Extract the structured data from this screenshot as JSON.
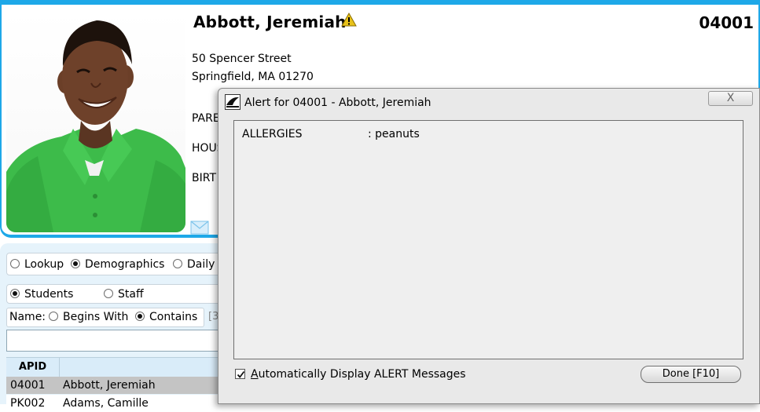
{
  "student": {
    "name": "Abbott, Jeremiah",
    "id": "04001",
    "address_line1": "50 Spencer Street",
    "address_line2": "Springfield, MA 01270",
    "label_parent": "PARE",
    "label_house": "HOUS",
    "label_birth": "BIRT"
  },
  "modes": {
    "lookup": "Lookup",
    "demographics": "Demographics",
    "daily": "Daily",
    "selected": "Demographics"
  },
  "person_type": {
    "students": "Students",
    "staff": "Staff",
    "selected": "Students"
  },
  "name_filter": {
    "label": "Name:",
    "begins_with": "Begins With",
    "contains": "Contains",
    "selected": "Contains",
    "extra": "[3"
  },
  "search": {
    "value": ""
  },
  "table": {
    "columns": [
      "APID",
      ""
    ],
    "rows": [
      {
        "apid": "04001",
        "name": "Abbott, Jeremiah",
        "selected": true
      },
      {
        "apid": "PK002",
        "name": "Adams, Camille",
        "selected": false
      }
    ]
  },
  "dialog": {
    "title": "Alert for 04001 - Abbott, Jeremiah",
    "close_glyph": "X",
    "alert_key": "ALLERGIES",
    "alert_value": ": peanuts",
    "auto_display_prefix": "A",
    "auto_display_rest": "utomatically Display ALERT Messages",
    "auto_display_checked": true,
    "done_label": "Done [F10]"
  },
  "colors": {
    "accent": "#1ea8e8",
    "warning": "#e8c21a",
    "shirt": "#3dbb4a",
    "selected_row": "#c4c4c4"
  },
  "icons": [
    "warning-icon",
    "mail-icon",
    "dialog-app-icon",
    "close-icon",
    "checkmark-icon"
  ]
}
